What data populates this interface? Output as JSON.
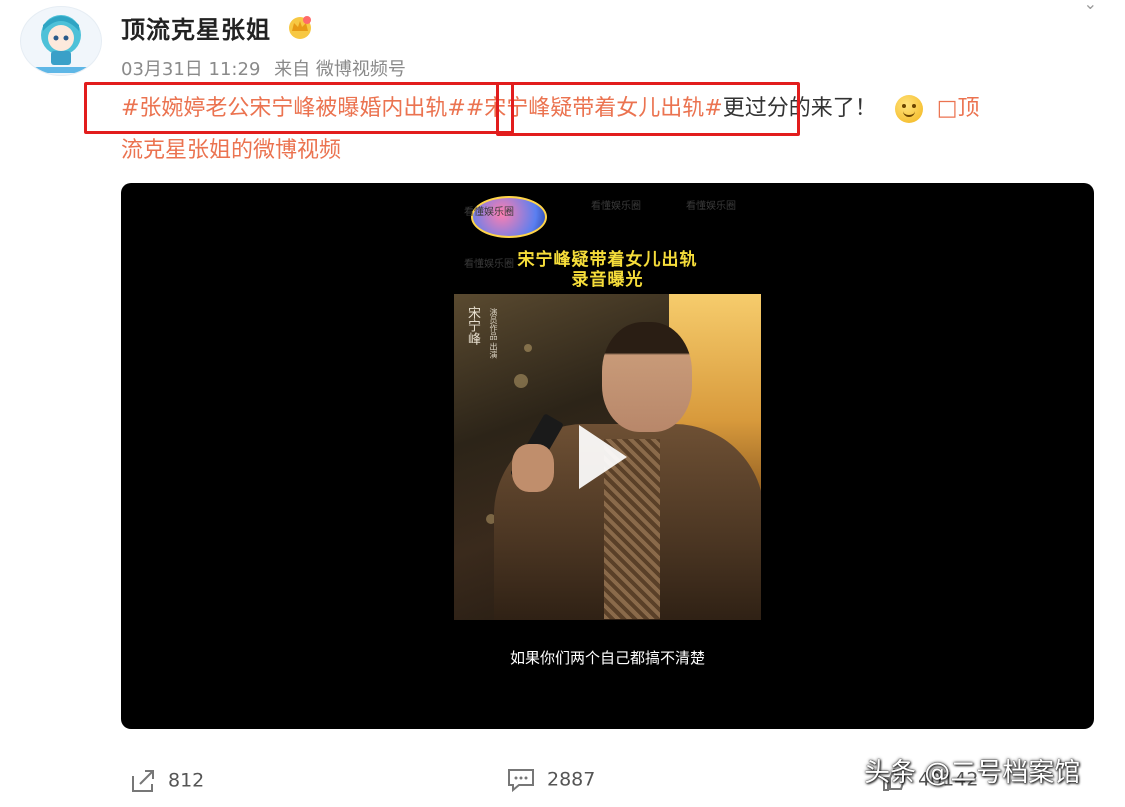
{
  "post": {
    "author": "顶流克星张姐",
    "date": "03月31日 11:29",
    "source": "来自 微博视频号",
    "hashtag1": "#张婉婷老公宋宁峰被曝婚内出轨#",
    "hashtag2": "#宋宁峰疑带着女儿出轨#",
    "text_after": "更过分的来了！",
    "video_link_prefix": "□顶",
    "video_link_rest": "流克星张姐的微博视频"
  },
  "video": {
    "poster_title_line1": "宋宁峰疑带着女儿出轨",
    "poster_title_line2": "录音曝光",
    "photo_caption": "宋宁峰",
    "photo_caption_small": "演员作品 出演",
    "subtitle": "如果你们两个自己都搞不清楚",
    "watermark": "看懂娱乐圈"
  },
  "actions": {
    "share_count": "812",
    "comment_count": "2887",
    "like_count": "40142"
  },
  "watermark": {
    "credit": "头条 @二号档案馆"
  },
  "colors": {
    "hashtag": "#eb7350",
    "highlight_box": "#e21d1d",
    "poster_title": "#f6dd3a"
  }
}
